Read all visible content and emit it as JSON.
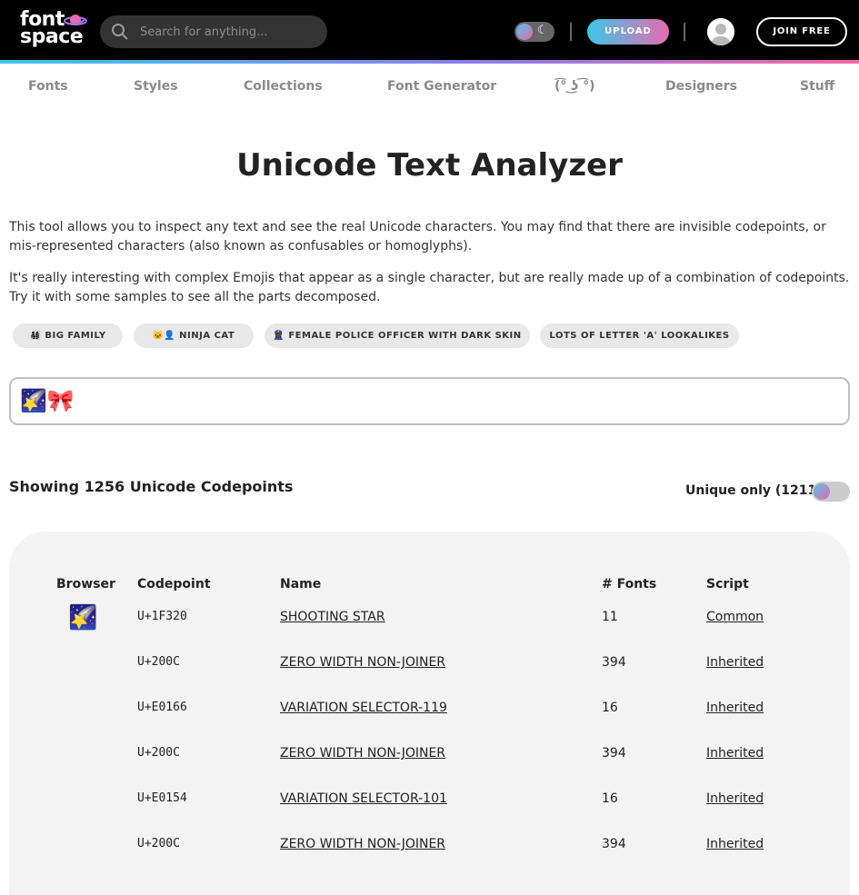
{
  "brand": {
    "line1": "font",
    "line2": "space"
  },
  "search": {
    "placeholder": "Search for anything..."
  },
  "header": {
    "upload_label": "UPLOAD",
    "join_label": "JOIN FREE"
  },
  "nav": [
    "Fonts",
    "Styles",
    "Collections",
    "Font Generator",
    "(͡° ͜ʖ ͡°)",
    "Designers",
    "Stuff"
  ],
  "page": {
    "title": "Unicode Text Analyzer",
    "para1": "This tool allows you to inspect any text and see the real Unicode characters. You may find that there are invisible codepoints, or mis-represented characters (also known as confusables or homoglyphs).",
    "para2": "It's really interesting with complex Emojis that appear as a single character, but are really made up of a combination of codepoints. Try it with some samples to see all the parts decomposed."
  },
  "samples": [
    {
      "icon": "👨‍👩‍👧‍👦",
      "label": "BIG FAMILY"
    },
    {
      "icon": "🐱‍👤",
      "label": "NINJA CAT"
    },
    {
      "icon": "👮🏿‍♀️",
      "label": "FEMALE POLICE OFFICER WITH DARK SKIN"
    },
    {
      "icon": "",
      "label": "LOTS OF LETTER 'A' LOOKALIKES"
    }
  ],
  "input": {
    "value": "🌠🎀"
  },
  "results": {
    "showing": "Showing 1256 Unicode Codepoints",
    "unique_label": "Unique only (1211)"
  },
  "table": {
    "headers": {
      "browser": "Browser",
      "codepoint": "Codepoint",
      "name": "Name",
      "fonts": "# Fonts",
      "script": "Script"
    },
    "rows": [
      {
        "browser": "🌠",
        "codepoint": "U+1F320",
        "name": "SHOOTING STAR",
        "fonts": "11",
        "script": "Common"
      },
      {
        "browser": "",
        "codepoint": "U+200C",
        "name": "ZERO WIDTH NON-JOINER",
        "fonts": "394",
        "script": "Inherited"
      },
      {
        "browser": "",
        "codepoint": "U+E0166",
        "name": "VARIATION SELECTOR-119",
        "fonts": "16",
        "script": "Inherited"
      },
      {
        "browser": "",
        "codepoint": "U+200C",
        "name": "ZERO WIDTH NON-JOINER",
        "fonts": "394",
        "script": "Inherited"
      },
      {
        "browser": "",
        "codepoint": "U+E0154",
        "name": "VARIATION SELECTOR-101",
        "fonts": "16",
        "script": "Inherited"
      },
      {
        "browser": "",
        "codepoint": "U+200C",
        "name": "ZERO WIDTH NON-JOINER",
        "fonts": "394",
        "script": "Inherited"
      }
    ]
  },
  "colors": {
    "accent_start": "#3cc8e6",
    "accent_end": "#e66ab0",
    "header_bg": "#000000"
  }
}
